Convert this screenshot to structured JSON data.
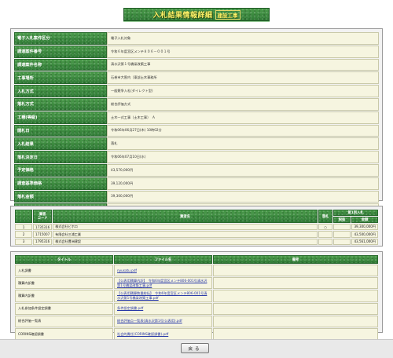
{
  "title": {
    "main": "入札結果情報詳細",
    "sub": "建設工事"
  },
  "details": [
    {
      "label": "電子入札案件区分",
      "value": "電子入札対象"
    },
    {
      "label": "調達案件番号",
      "value": "令和６年度宮区メンテ８０６－００１号"
    },
    {
      "label": "調達案件名称",
      "value": "清水沢第１号橋梁改築工事"
    },
    {
      "label": "工事場所",
      "value": "石巻市大曽内（東部土木事務所"
    },
    {
      "label": "入札方式",
      "value": "一般競争入札(ダイレクト型)"
    },
    {
      "label": "落札方式",
      "value": "総合評価方式"
    },
    {
      "label": "工種(等級)",
      "value": "土木一式工事（土木工事）　Ａ"
    },
    {
      "label": "開札日",
      "value": "令和06年06月27日(木) 10時02分"
    },
    {
      "label": "入札結果",
      "value": "落札"
    },
    {
      "label": "落札決定日",
      "value": "令和06年07月10日(水)"
    },
    {
      "label": "予定価格",
      "value": "43,570,000円"
    },
    {
      "label": "調査基準価格",
      "value": "39,120,000円"
    },
    {
      "label": "落札金額",
      "value": "39,300,000円"
    },
    {
      "label": "落札業者名",
      "value": "株式会社ビホロ"
    },
    {
      "label": "落札業者住所",
      "value": "宮城県牡鹿郡女川町清水浜字清水７５－５"
    }
  ],
  "bidders": {
    "headers": {
      "code": "業者\nコード",
      "name": "業者名",
      "award": "落札",
      "amount_group": "第1回入札",
      "amount_first": "税抜",
      "amount_total": "金額"
    },
    "rows": [
      {
        "no": "1",
        "code": "1735316",
        "name": "株式会社ビホロ",
        "award": "○",
        "first": "",
        "total": "39,300,000円"
      },
      {
        "no": "2",
        "code": "1715007",
        "name": "有限会社三浦工業",
        "award": "",
        "first": "",
        "total": "43,500,000円"
      },
      {
        "no": "3",
        "code": "1795316",
        "name": "株式会社豊洲建設",
        "award": "",
        "first": "",
        "total": "43,561,000円"
      }
    ]
  },
  "documents": {
    "headers": {
      "title": "タイトル",
      "file": "ファイル名",
      "note": "備考"
    },
    "rows": [
      {
        "title": "入札調書",
        "file": "nyusatu.pdf",
        "note": ""
      },
      {
        "title": "積算内訳書",
        "file": "【公表用積算内訳】　令和6年度宮区メンテ806-001号清水沢第1号橋梁改築工事.pdf",
        "note": ""
      },
      {
        "title": "積算内訳書",
        "file": "【公表用積算数量総括】　令和6年度宮区メンテ806-001号清水沢第1号橋梁改築工事.pdf",
        "note": ""
      },
      {
        "title": "入札参加条件設定調書",
        "file": "条件設定調書.pdf",
        "note": ""
      },
      {
        "title": "総合評価一覧表",
        "file": "総合評価点一覧表(清水沢第1号(公表用).pdf",
        "note": ""
      },
      {
        "title": "CORINS確認調書",
        "file": "社会的責任(CORINS確認調書).pdf",
        "note": ""
      }
    ]
  },
  "back_button": "戻る"
}
